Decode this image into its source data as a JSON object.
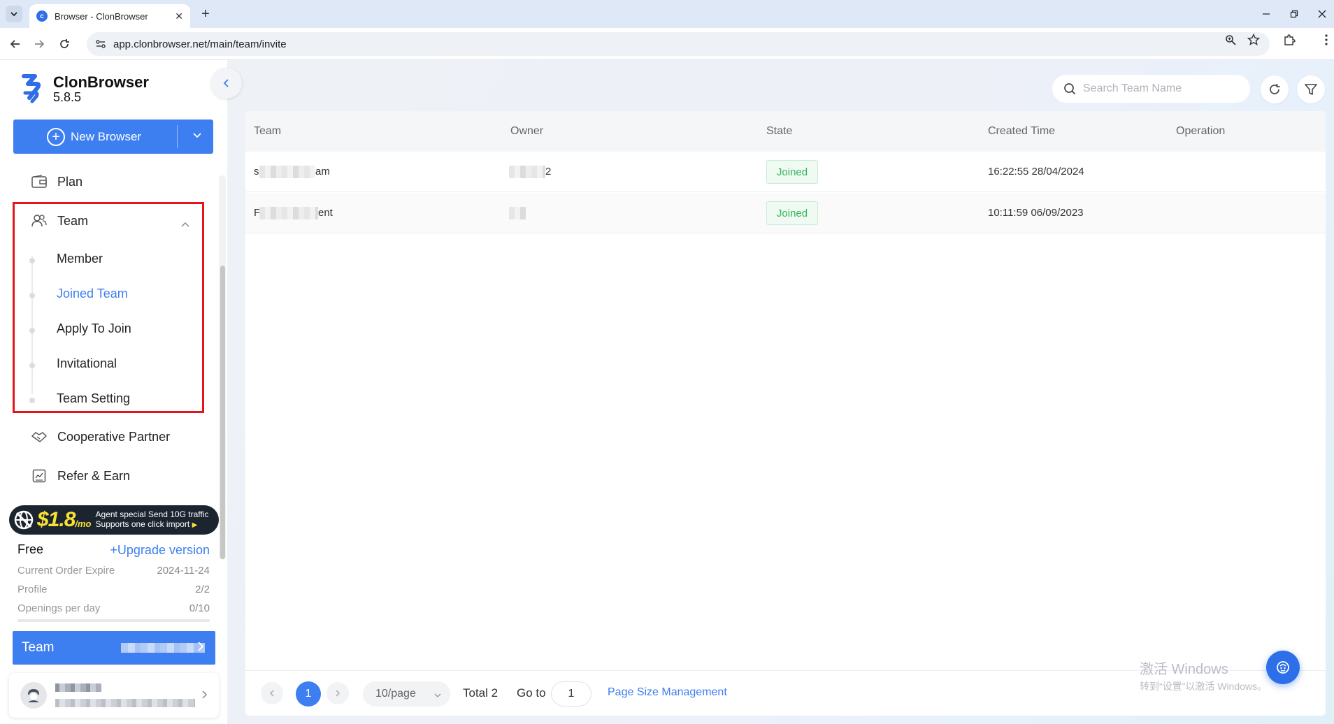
{
  "browser": {
    "tab_title": "Browser - ClonBrowser",
    "url": "app.clonbrowser.net/main/team/invite"
  },
  "app": {
    "name": "ClonBrowser",
    "version": "5.8.5"
  },
  "sidebar": {
    "new_browser_label": "New Browser",
    "plan_label": "Plan",
    "team_label": "Team",
    "team_sub_items": [
      "Member",
      "Joined Team",
      "Apply To Join",
      "Invitational",
      "Team Setting"
    ],
    "active_sub_item": "Joined Team",
    "cooperative_label": "Cooperative Partner",
    "refer_label": "Refer & Earn",
    "promo": {
      "price": "$1.8",
      "unit": "/mo",
      "line1": "Agent special Send 10G traffic",
      "line2": "Supports one click import"
    },
    "plan_info": {
      "plan_name": "Free",
      "upgrade_label": "+Upgrade version",
      "rows": [
        {
          "label": "Current Order Expire",
          "value": "2024-11-24"
        },
        {
          "label": "Profile",
          "value": "2/2"
        },
        {
          "label": "Openings per day",
          "value": "0/10"
        }
      ]
    },
    "team_bar_label": "Team"
  },
  "main": {
    "search_placeholder": "Search Team Name",
    "table": {
      "columns": [
        "Team",
        "Owner",
        "State",
        "Created Time",
        "Operation"
      ],
      "rows": [
        {
          "team_prefix": "s",
          "team_suffix": "am",
          "owner_suffix": "2",
          "state": "Joined",
          "created": "16:22:55 28/04/2024"
        },
        {
          "team_prefix": "F",
          "team_suffix": "ent",
          "owner_suffix": "",
          "state": "Joined",
          "created": "10:11:59 06/09/2023"
        }
      ]
    },
    "pagination": {
      "current_page": "1",
      "page_size": "10/page",
      "total": "Total 2",
      "goto_label": "Go to",
      "goto_value": "1",
      "size_mgmt_label": "Page Size Management"
    }
  },
  "watermark": {
    "line1": "激活 Windows",
    "line2": "转到“设置”以激活 Windows。"
  },
  "colors": {
    "primary": "#3d7ef0",
    "success": "#34b35a",
    "highlight": "#e3141c"
  }
}
